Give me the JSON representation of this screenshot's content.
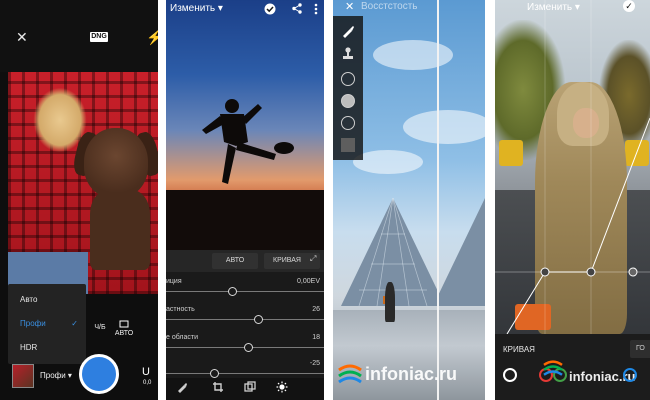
{
  "panel1": {
    "dng_badge": "DNG",
    "close_glyph": "✕",
    "flash_glyph": "⚡",
    "menu_items": [
      {
        "label": "Авто",
        "selected": false
      },
      {
        "label": "Профи",
        "selected": true
      },
      {
        "label": "HDR",
        "selected": false
      }
    ],
    "check_glyph": "✓",
    "modes": [
      "Ч/Б",
      "АВТО"
    ],
    "bottom_mode": "Профи ▾",
    "exposure_value": "0,0"
  },
  "panel2": {
    "title": "Изменить ▾",
    "pills": [
      "АВТО",
      "КРИВАЯ"
    ],
    "sliders": [
      {
        "label": "иция",
        "value": "0,00EV",
        "position": 0.42
      },
      {
        "label": "астность",
        "value": "26",
        "position": 0.58
      },
      {
        "label": "е области",
        "value": "18",
        "position": 0.52
      },
      {
        "label": "",
        "value": "-25",
        "position": 0.3
      }
    ],
    "bottom_icons": [
      "brush-icon",
      "crop-icon",
      "layers-icon",
      "sun-icon"
    ]
  },
  "panel3": {
    "top_text": "Восстстость",
    "close_glyph": "✕",
    "tools": [
      "brush-icon",
      "stamp-icon",
      "circle-small-icon",
      "circle-large-icon",
      "circle-outline-icon",
      "square-icon"
    ],
    "watermark": "infoniac.ru"
  },
  "panel4": {
    "title": "Изменить ▾",
    "check_glyph": "✓",
    "curve_label": "КРИВАЯ",
    "curve_button": "ГО",
    "watermark": "infoniac.ru",
    "channel_colors": [
      "#ffffff",
      "#e53935",
      "#43a047",
      "#1e88e5"
    ]
  },
  "colors": {
    "accent_blue": "#2e7fe0",
    "orange": "#e06624"
  }
}
